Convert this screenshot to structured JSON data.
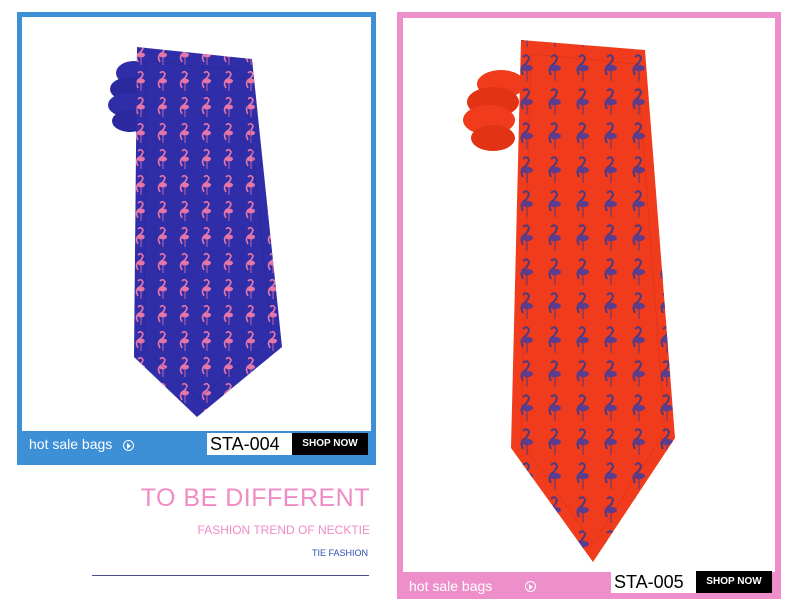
{
  "cards": [
    {
      "id": "blue",
      "border_color": "#3d8fd6",
      "tie_color": "#2f2ea8",
      "pattern_color": "#f07aa8",
      "hot_label": "hot sale bags",
      "code": "STA-004",
      "shop_label": "SHOP NOW"
    },
    {
      "id": "pink",
      "border_color": "#ee8fcb",
      "tie_color": "#f03c1c",
      "pattern_color": "#3a3a8a",
      "hot_label": "hot sale bags",
      "code": "STA-005",
      "shop_label": "SHOP NOW"
    }
  ],
  "promo": {
    "headline": "TO BE DIFFERENT",
    "subhead": "FASHION TREND OF NECKTIE",
    "tagline": "TIE FASHION"
  }
}
